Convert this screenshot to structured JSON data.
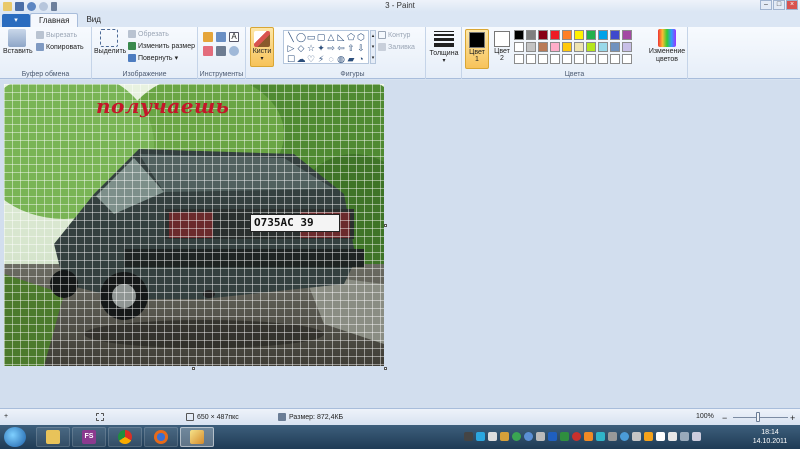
{
  "window": {
    "title": "3 - Paint"
  },
  "tabs": {
    "app_menu": "▾",
    "home": "Главная",
    "view": "Вид"
  },
  "clipboard": {
    "paste": "Вставить",
    "cut": "Вырезать",
    "copy": "Копировать",
    "group": "Буфер обмена"
  },
  "image_group": {
    "select": "Выделить",
    "crop": "Обрезать",
    "resize": "Изменить размер",
    "rotate": "Повернуть",
    "group": "Изображение"
  },
  "tools": {
    "group": "Инструменты"
  },
  "brushes": {
    "label": "Кисти"
  },
  "shapes": {
    "group": "Фигуры",
    "outline": "Контур",
    "fill": "Заливка",
    "glyphs": [
      "╲",
      "◯",
      "▭",
      "▢",
      "△",
      "◺",
      "⬠",
      "⬡",
      "▷",
      "◇",
      "☆",
      "✦",
      "⇨",
      "⇦",
      "⇧",
      "⇩",
      "☐",
      "☁",
      "♡",
      "⚡",
      "◌",
      "◍",
      "▰",
      "◔"
    ]
  },
  "size": {
    "label": "Толщина"
  },
  "colors": {
    "group": "Цвета",
    "color1": {
      "label": "Цвет",
      "num": "1",
      "value": "#000000"
    },
    "color2": {
      "label": "Цвет",
      "num": "2",
      "value": "#ffffff"
    },
    "edit": "Изменение цветов",
    "palette": [
      "#000000",
      "#7f7f7f",
      "#880015",
      "#ed1c24",
      "#ff7f27",
      "#fff200",
      "#22b14c",
      "#00a2e8",
      "#3f48cc",
      "#a349a4",
      "#ffffff",
      "#c3c3c3",
      "#b97a57",
      "#ffaec9",
      "#ffc90e",
      "#efe4b0",
      "#b5e61d",
      "#99d9ea",
      "#7092be",
      "#c8bfe7",
      "#ffffff",
      "#ffffff",
      "#ffffff",
      "#ffffff",
      "#ffffff",
      "#ffffff",
      "#ffffff",
      "#ffffff",
      "#ffffff",
      "#ffffff"
    ]
  },
  "canvas": {
    "caption": "получаешь",
    "plate": "O735AC 39"
  },
  "status": {
    "dimensions": "650 × 487пкс",
    "size": "Размер: 872,4КБ",
    "zoom": "100%"
  },
  "taskbar": {
    "fs_label": "FS",
    "time": "18:14",
    "date": "14.10.2011"
  }
}
